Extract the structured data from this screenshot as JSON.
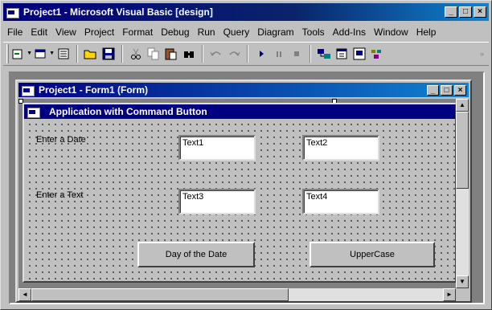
{
  "app": {
    "title": "Project1 - Microsoft Visual Basic [design]",
    "buttons": {
      "minimize": "_",
      "maximize": "□",
      "close": "×"
    }
  },
  "menu": [
    "File",
    "Edit",
    "View",
    "Project",
    "Format",
    "Debug",
    "Run",
    "Query",
    "Diagram",
    "Tools",
    "Add-Ins",
    "Window",
    "Help"
  ],
  "toolbar": {
    "icons": [
      "add-project-icon",
      "add-form-icon",
      "menu-editor-icon",
      "open-icon",
      "save-icon",
      "cut-icon",
      "copy-icon",
      "paste-icon",
      "find-icon",
      "undo-icon",
      "redo-icon",
      "start-icon",
      "break-icon",
      "end-icon",
      "project-explorer-icon",
      "properties-icon",
      "form-layout-icon",
      "object-browser-icon"
    ],
    "overflow": "»"
  },
  "form_window": {
    "title": "Project1 - Form1 (Form)"
  },
  "form": {
    "caption": "Application with Command Button",
    "label_date": "Enter a Date",
    "label_text": "Enter a Text",
    "text1": "Text1",
    "text2": "Text2",
    "text3": "Text3",
    "text4": "Text4",
    "button_day": "Day of the Date",
    "button_upper": "UpperCase"
  },
  "colors": {
    "titlebar": "#000080",
    "face": "#c0c0c0",
    "workspace": "#808080"
  }
}
